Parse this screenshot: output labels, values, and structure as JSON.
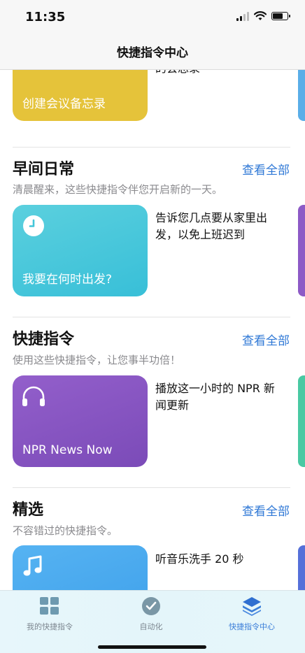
{
  "status": {
    "time": "11:35"
  },
  "nav": {
    "title": "快捷指令中心"
  },
  "top_card": {
    "title": "创建会议备忘录",
    "desc_partial": "的会总录",
    "color": "#e5c33a"
  },
  "sections": [
    {
      "title": "早间日常",
      "link": "查看全部",
      "subtitle": "清晨醒来，这些快捷指令伴您开启新的一天。",
      "card": {
        "title": "我要在何时出发?",
        "desc": "告诉您几点要从家里出发，以免上班迟到",
        "icon": "clock-icon",
        "color": "#43c6d9"
      }
    },
    {
      "title": "快捷指令",
      "link": "查看全部",
      "subtitle": "使用这些快捷指令，让您事半功倍！",
      "card": {
        "title": "NPR News Now",
        "desc": "播放这一小时的 NPR 新闻更新",
        "icon": "headphones-icon",
        "color": "#8455c0"
      }
    },
    {
      "title": "精选",
      "link": "查看全部",
      "subtitle": "不容错过的快捷指令。",
      "card": {
        "title": "",
        "desc": "听音乐洗手 20 秒",
        "icon": "music-note-icon",
        "color": "#4aa7ef"
      }
    }
  ],
  "tabs": [
    {
      "label": "我的快捷指令",
      "icon": "grid-icon",
      "active": false
    },
    {
      "label": "自动化",
      "icon": "clock-check-icon",
      "active": false
    },
    {
      "label": "快捷指令中心",
      "icon": "layers-icon",
      "active": true
    }
  ]
}
